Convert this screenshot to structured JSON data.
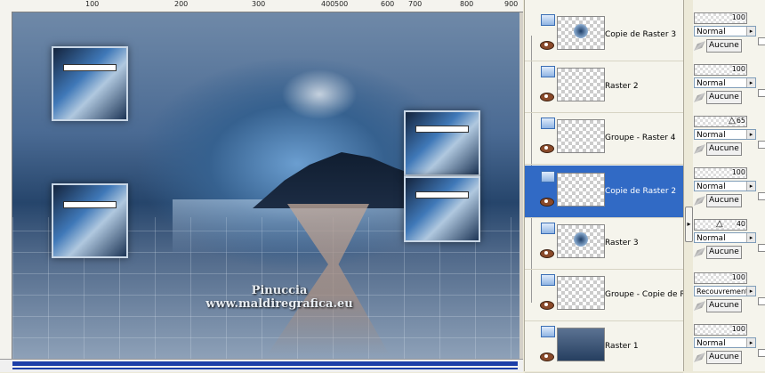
{
  "ruler": {
    "labels": [
      "100",
      "200",
      "300",
      "400",
      "500",
      "600",
      "700",
      "800",
      "900"
    ]
  },
  "watermark": {
    "line1": "Pinuccia",
    "line2": "www.maldiregrafica.eu"
  },
  "layers": [
    {
      "name": "Copie de Raster 3",
      "selected": false,
      "opacity": "100",
      "blend": "Normal",
      "mask": "Aucune"
    },
    {
      "name": "Raster 2",
      "selected": false,
      "opacity": "100",
      "blend": "Normal",
      "mask": "Aucune"
    },
    {
      "name": "Groupe - Raster 4",
      "selected": false,
      "opacity": "65",
      "blend": "Normal",
      "mask": "Aucune"
    },
    {
      "name": "Copie de Raster 2",
      "selected": true,
      "opacity": "100",
      "blend": "Normal",
      "mask": "Aucune"
    },
    {
      "name": "Raster 3",
      "selected": false,
      "opacity": "40",
      "blend": "Normal",
      "mask": "Aucune"
    },
    {
      "name": "Groupe - Copie de Ra",
      "selected": false,
      "opacity": "100",
      "blend": "Recouvrement",
      "mask": "Aucune"
    },
    {
      "name": "Raster 1",
      "selected": false,
      "opacity": "100",
      "blend": "Normal",
      "mask": "Aucune"
    }
  ],
  "colors": {
    "selection": "#316ac5",
    "scroll_accent": "#1d3fa8"
  },
  "icons": {
    "visibility": "layer-visibility-icon",
    "eye": "eye-icon",
    "mask": "mask-brush-icon",
    "dropdown": "dropdown-arrow-icon"
  }
}
